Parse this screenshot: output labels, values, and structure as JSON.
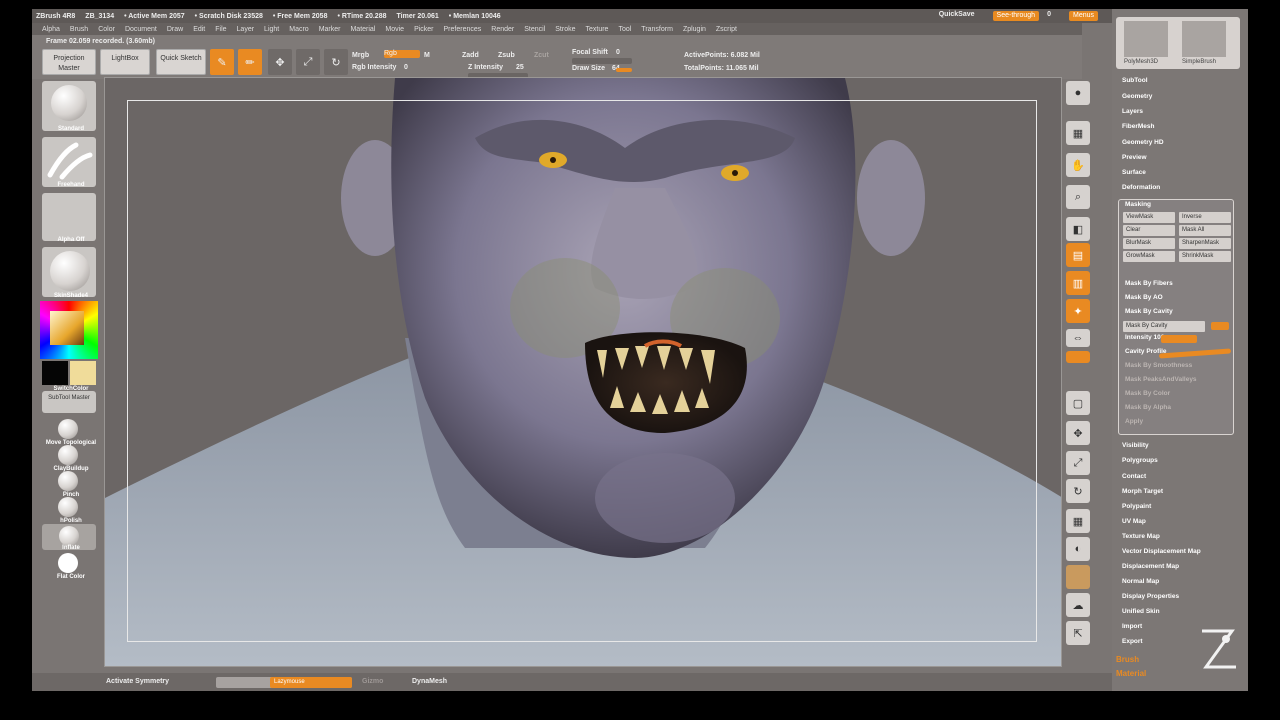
{
  "title_bar": {
    "items": [
      "ZBrush 4R8",
      "ZB_3134",
      "• Active Mem 2057",
      "• Scratch Disk 23528",
      "• Free Mem 2058",
      "• RTime 20.288",
      "Timer 20.061",
      "• Memlan 10046"
    ],
    "right_items": [
      "QuickSave",
      "See-through",
      "0",
      "Menus"
    ]
  },
  "menu_bar": [
    "Alpha",
    "Brush",
    "Color",
    "Document",
    "Draw",
    "Edit",
    "File",
    "Layer",
    "Light",
    "Macro",
    "Marker",
    "Material",
    "Movie",
    "Picker",
    "Preferences",
    "Render",
    "Stencil",
    "Stroke",
    "Texture",
    "Tool",
    "Transform",
    "Zplugin",
    "Zscript"
  ],
  "shelf": {
    "frame_status": "Frame 02.059 recorded. (3.60mb)",
    "projection_master": "Projection Master",
    "lightbox": "LightBox",
    "quick_sketch": "Quick Sketch",
    "edit": "Edit",
    "draw": "Draw",
    "move": "Move",
    "scale": "Scale",
    "rotate": "Rotate",
    "mrgb": "Mrgb",
    "rgb": "Rgb",
    "m": "M",
    "zadd": "Zadd",
    "zsub": "Zsub",
    "zcut": "Zcut",
    "focal_shift": "Focal Shift",
    "focal_shift_value": "0",
    "draw_size": "Draw Size",
    "draw_size_value": "64",
    "rgb_intensity": "Rgb Intensity",
    "rgb_intensity_value": "0",
    "z_intensity": "Z Intensity",
    "z_intensity_value": "25",
    "active_points": "ActivePoints: 6.082 Mil",
    "total_points": "TotalPoints: 11.065 Mil"
  },
  "left_shelf": {
    "brush": "Standard",
    "stroke": "Freehand",
    "alpha": "Alpha Off",
    "material": "SkinShade4",
    "gradient": "Gradient",
    "switch_color": "SwitchColor",
    "subtool_master": "SubTool Master",
    "quick_brushes": [
      "Move Topological",
      "ClayBuildup",
      "Pinch",
      "hPolish",
      "Inflate",
      "Flat Color"
    ]
  },
  "right_shelf": [
    "BPR",
    "SPix 3",
    "Scroll",
    "Zoom",
    "Actual",
    "AAHalf",
    "Persp",
    "Floor",
    "Local",
    "L.Sym",
    "Frame",
    "Move",
    "Scale",
    "Rotate",
    "Line Fill",
    "Transp",
    "Solo",
    "Xpose"
  ],
  "tool_palette": {
    "thumbs": [
      "PolyMesh3D",
      "SimpleBrush"
    ],
    "items_top": [
      "SubTool",
      "Geometry",
      "Layers",
      "FiberMesh",
      "Geometry HD",
      "Preview",
      "Surface",
      "Deformation"
    ],
    "masking": {
      "title": "Masking",
      "buttons": [
        "ViewMask",
        "Inverse",
        "Clear",
        "Mask All",
        "BlurMask",
        "SharpenMask",
        "GrowMask",
        "ShrinkMask"
      ],
      "items": [
        "Mask By Fibers",
        "Mask By AO",
        "Mask By Cavity",
        "Mask By Cavity",
        "Intensity 100",
        "Cavity Profile",
        "Mask By Smoothness",
        "Mask PeaksAndValleys",
        "Mask By Color",
        "Mask By Alpha",
        "Apply"
      ]
    },
    "items_bottom": [
      "Visibility",
      "Polygroups",
      "Contact",
      "Morph Target",
      "Polypaint",
      "UV Map",
      "Texture Map",
      "Vector Displacement Map",
      "Displacement Map",
      "Normal Map",
      "Display Properties",
      "Unified Skin",
      "Import",
      "Export"
    ],
    "bottom_buttons": [
      "Brush",
      "Material"
    ]
  },
  "bottom_bar": {
    "activate_symmetry": "Activate Symmetry",
    "slider_label": "Lazymouse",
    "mid": "Gizmo",
    "right": "DynaMesh"
  },
  "colors": {
    "accent": "#e98a22",
    "bg": "#7a7573"
  }
}
